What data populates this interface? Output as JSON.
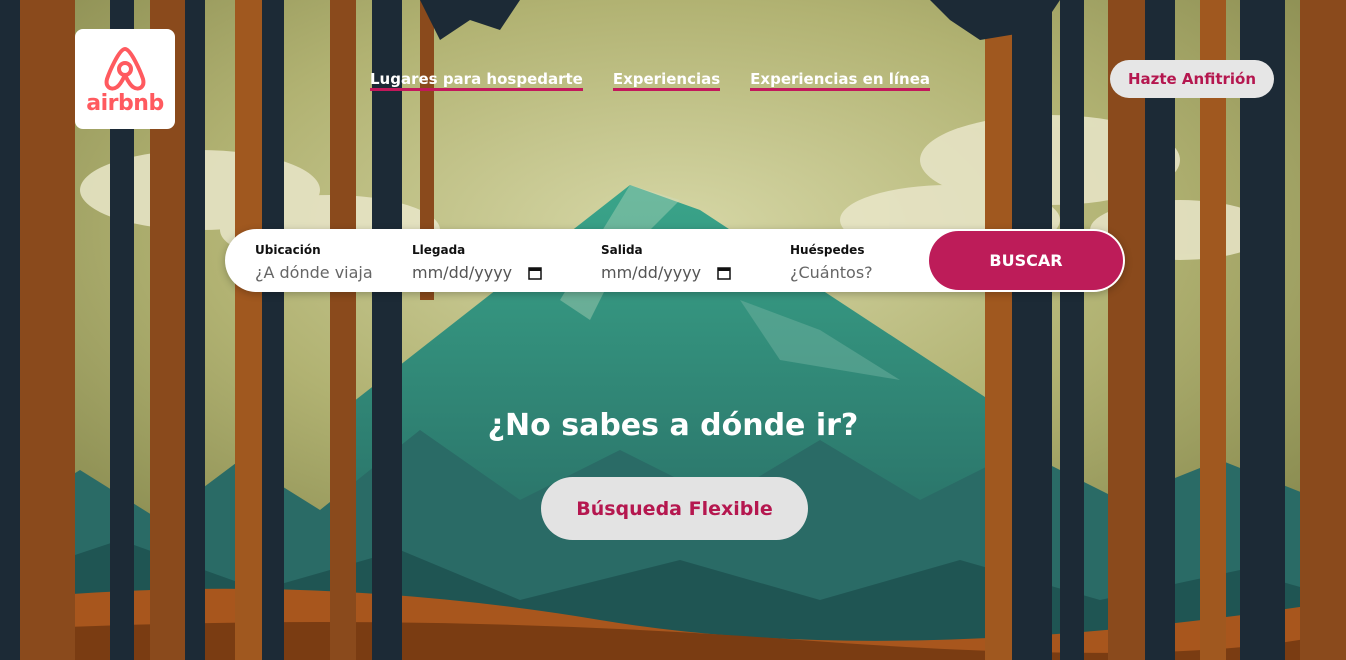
{
  "brand": {
    "name": "airbnb",
    "color": "#ff5a5f"
  },
  "nav": {
    "items": [
      {
        "label": "Lugares para hospedarte"
      },
      {
        "label": "Experiencias"
      },
      {
        "label": "Experiencias en línea"
      }
    ]
  },
  "host_button": {
    "label": "Hazte Anfitrión"
  },
  "search": {
    "location": {
      "label": "Ubicación",
      "placeholder": "¿A dónde viaja"
    },
    "checkin": {
      "label": "Llegada",
      "placeholder": "mm/dd/yyyy",
      "icon": "calendar-icon"
    },
    "checkout": {
      "label": "Salida",
      "placeholder": "mm/dd/yyyy",
      "icon": "calendar-icon"
    },
    "guests": {
      "label": "Huéspedes",
      "placeholder": "¿Cuántos?"
    },
    "button": {
      "label": "BUSCAR"
    }
  },
  "hero": {
    "question": "¿No sabes a dónde ir?",
    "flexible_button": "Búsqueda Flexible"
  },
  "colors": {
    "accent": "#bd1c59",
    "sky": "#a9a86a",
    "mountain": "#2f7d73",
    "trunk": "#8a4a1c",
    "tree_dark": "#1c2a36"
  }
}
